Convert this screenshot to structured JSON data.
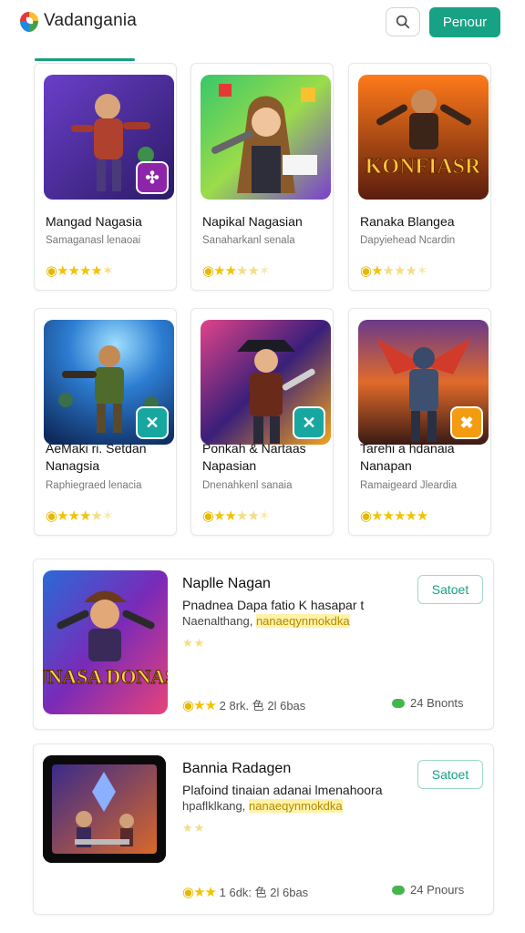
{
  "header": {
    "app_name": "Vadangania",
    "primary_button": "Penour",
    "search_icon": "search-icon",
    "logo_icon": "colorful-leaf-logo-icon",
    "accent_color": "#17a285"
  },
  "grid": [
    {
      "title": "Mangad Nagasia",
      "subtitle": "Samaganasl lenaoai",
      "stars_icon": "coin-and-stars",
      "badge_icon": "sparkle-icon",
      "badge_color": "#8e24aa"
    },
    {
      "title": "Napikal Nagasian",
      "subtitle": "Sanaharkanl senala",
      "stars_icon": "coin-and-stars"
    },
    {
      "title": "Ranaka Blangea",
      "subtitle": "Dapyiehead Ncardin",
      "stars_icon": "coin-and-stars",
      "thumb_caption": "KONFIASR"
    },
    {
      "title": "AeMaki ri. Setdan Nanagsia",
      "subtitle": "Raphiegraed lenacia",
      "stars_icon": "coin-and-stars",
      "badge_icon": "sword-icon",
      "badge_color": "#18a7a0"
    },
    {
      "title": "Ponkah & Nartaas Napasian",
      "subtitle": "Dnenahkenl sanaia",
      "stars_icon": "coin-and-stars",
      "badge_icon": "sword-icon",
      "badge_color": "#18a7a0"
    },
    {
      "title": "Tarehi a hdanaia Nanapan",
      "subtitle": "Ramaigeard Jleardia",
      "stars_icon": "coin-and-stars",
      "badge_icon": "crossed-swords-icon",
      "badge_color": "#f39c12"
    }
  ],
  "list": [
    {
      "title": "Naplle Nagan",
      "line1": "Pnadnea Dapa fatio K hasapar t",
      "line2_plain": "Naenalthang, ",
      "line2_highlight": "nanaeqynmokdka",
      "select_label": "Satoet",
      "rating_text": "2 8rk. ⾊ 2l 6bas",
      "count_text": "24 Bnonts",
      "thumb_caption": "DUNASA DONASA"
    },
    {
      "title": "Bannia Radagen",
      "line1": "Plafoind tinaian adanai lmenahoora",
      "line2_plain": "hpaflklkang, ",
      "line2_highlight": "nanaeqynmokdka",
      "select_label": "Satoet",
      "rating_text": "1 6dk: ⾊ 2l 6bas",
      "count_text": "24 Pnours"
    }
  ]
}
